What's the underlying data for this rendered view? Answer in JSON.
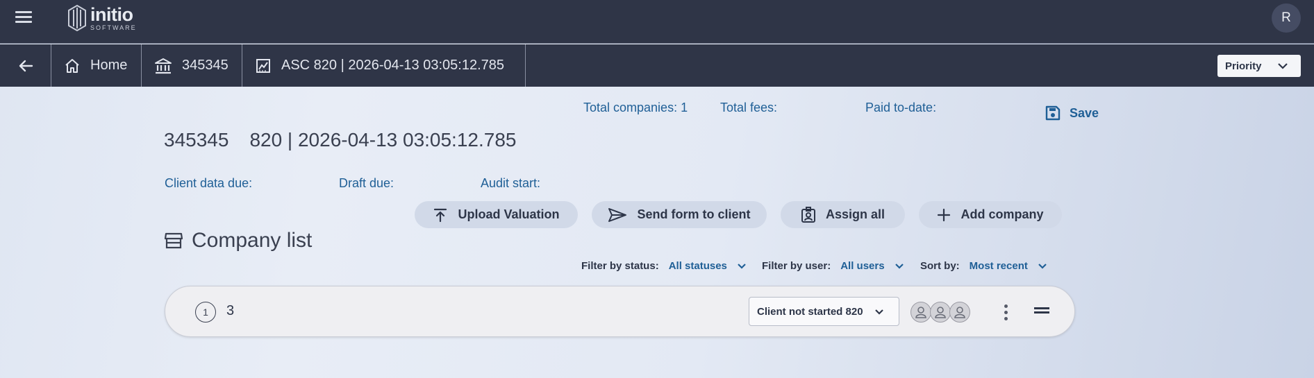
{
  "app": {
    "logo_name": "initio",
    "logo_sub": "SOFTWARE",
    "user_initial": "R"
  },
  "breadcrumbs": [
    {
      "label": "Home",
      "icon": "home-icon"
    },
    {
      "label": "345345",
      "icon": "bank-icon"
    },
    {
      "label": "ASC 820 | 2026-04-13 03:05:12.785",
      "icon": "chart-icon"
    }
  ],
  "priority": {
    "label": "Priority"
  },
  "stats": {
    "total_companies": "Total companies: 1",
    "total_fees": "Total fees:",
    "paid_to_date": "Paid to-date:"
  },
  "save_label": "Save",
  "title": {
    "id": "345345",
    "name": "820 | 2026-04-13 03:05:12.785"
  },
  "dates": {
    "client_data_due": "Client data due:",
    "draft_due": "Draft due:",
    "audit_start": "Audit start:"
  },
  "actions": {
    "upload": "Upload Valuation",
    "send": "Send form to client",
    "assign": "Assign all",
    "add": "Add company"
  },
  "company_list": {
    "title": "Company list",
    "filter_status_label": "Filter by status:",
    "filter_status_value": "All statuses",
    "filter_user_label": "Filter by user:",
    "filter_user_value": "All users",
    "sort_label": "Sort by:",
    "sort_value": "Most recent",
    "rows": [
      {
        "number": "1",
        "name": "3",
        "status": "Client not started 820"
      }
    ]
  },
  "colors": {
    "header_bg": "#2f3547",
    "accent": "#1f5f96",
    "action_pill": "#d1d9e8"
  }
}
